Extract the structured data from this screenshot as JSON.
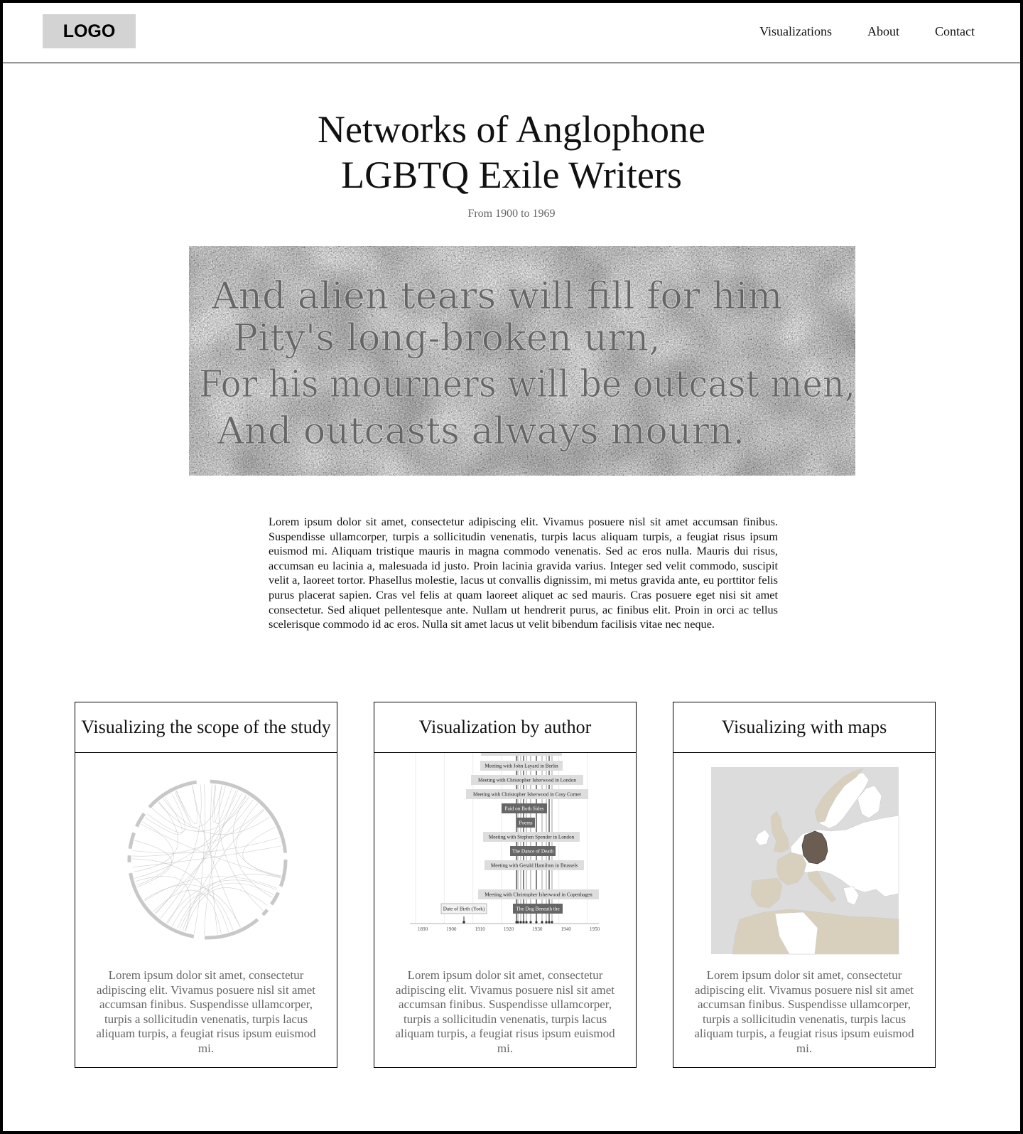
{
  "header": {
    "logo": "LOGO",
    "nav": [
      "Visualizations",
      "About",
      "Contact"
    ]
  },
  "hero": {
    "title_line1": "Networks of Anglophone",
    "title_line2": "LGBTQ Exile Writers",
    "subtitle": "From 1900 to 1969",
    "image_inscription": [
      "And alien tears will fill for him",
      "Pity's long-broken urn,",
      "For his mourners will be outcast men,",
      "And outcasts always mourn."
    ]
  },
  "intro": "Lorem ipsum dolor sit amet, consectetur adipiscing elit. Vivamus posuere nisl sit amet accumsan finibus. Suspendisse ullamcorper, turpis a sollicitudin venenatis, turpis lacus aliquam turpis, a feugiat risus ipsum euismod mi. Aliquam tristique mauris in magna commodo venenatis. Sed ac eros nulla. Mauris dui risus, accumsan eu lacinia a, malesuada id justo. Proin lacinia gravida varius. Integer sed velit commodo, suscipit velit a, laoreet tortor. Phasellus molestie, lacus ut convallis dignissim, mi metus gravida ante, eu porttitor felis purus placerat sapien. Cras vel felis at quam laoreet aliquet ac sed mauris. Cras posuere eget nisi sit amet consectetur. Sed aliquet pellentesque ante. Nullam ut hendrerit purus, ac finibus elit. Proin in orci ac tellus scelerisque commodo id ac eros. Nulla sit amet lacus ut velit bibendum facilisis vitae nec neque.",
  "cards": [
    {
      "title": "Visualizing the scope of the study",
      "text": "Lorem ipsum dolor sit amet, consectetur adipiscing elit. Vivamus posuere nisl sit amet accumsan finibus. Suspendisse ullamcorper, turpis a sollicitudin venenatis, turpis lacus aliquam turpis, a feugiat risus ipsum euismod mi."
    },
    {
      "title": "Visualization by author",
      "text": "Lorem ipsum dolor sit amet, consectetur adipiscing elit. Vivamus posuere nisl sit amet accumsan finibus. Suspendisse ullamcorper, turpis a sollicitudin venenatis, turpis lacus aliquam turpis, a feugiat risus ipsum euismod mi.",
      "timeline": {
        "axis_ticks": [
          "1890",
          "1900",
          "1910",
          "1920",
          "1930",
          "1940",
          "1950"
        ],
        "events": [
          {
            "label": "Meeting with John Layard in Berlin",
            "kind": "meeting"
          },
          {
            "label": "Meeting with Christopher Isherwood in London",
            "kind": "meeting"
          },
          {
            "label": "Meeting with Christopher Isherwood in Cosy Corner",
            "kind": "meeting"
          },
          {
            "label": "Paid on Both Sides",
            "kind": "work"
          },
          {
            "label": "Poems",
            "kind": "work"
          },
          {
            "label": "Meeting with Stephen Spender in London",
            "kind": "meeting"
          },
          {
            "label": "The Dance of Death",
            "kind": "work"
          },
          {
            "label": "Meeting with Gerald Hamilton in Brussels",
            "kind": "meeting"
          },
          {
            "label": "Meeting with Christopher Isherwood in Copenhagen",
            "kind": "meeting"
          },
          {
            "label": "Date of Birth (York)",
            "kind": "birth"
          },
          {
            "label": "The Dog Beneath the",
            "kind": "work"
          }
        ]
      }
    },
    {
      "title": "Visualizing with maps",
      "text": "Lorem ipsum dolor sit amet, consectetur adipiscing elit. Vivamus posuere nisl sit amet accumsan finibus. Suspendisse ullamcorper, turpis a sollicitudin venenatis, turpis lacus aliquam turpis, a feugiat risus ipsum euismod mi."
    }
  ],
  "colors": {
    "border": "#000000",
    "logo_bg": "#d3d3d3",
    "subtle_text": "#666666",
    "map_highlight": "#6b5d52",
    "map_visited": "#d8d0bd",
    "map_land": "#ffffff",
    "map_water": "#dcdcdc"
  }
}
